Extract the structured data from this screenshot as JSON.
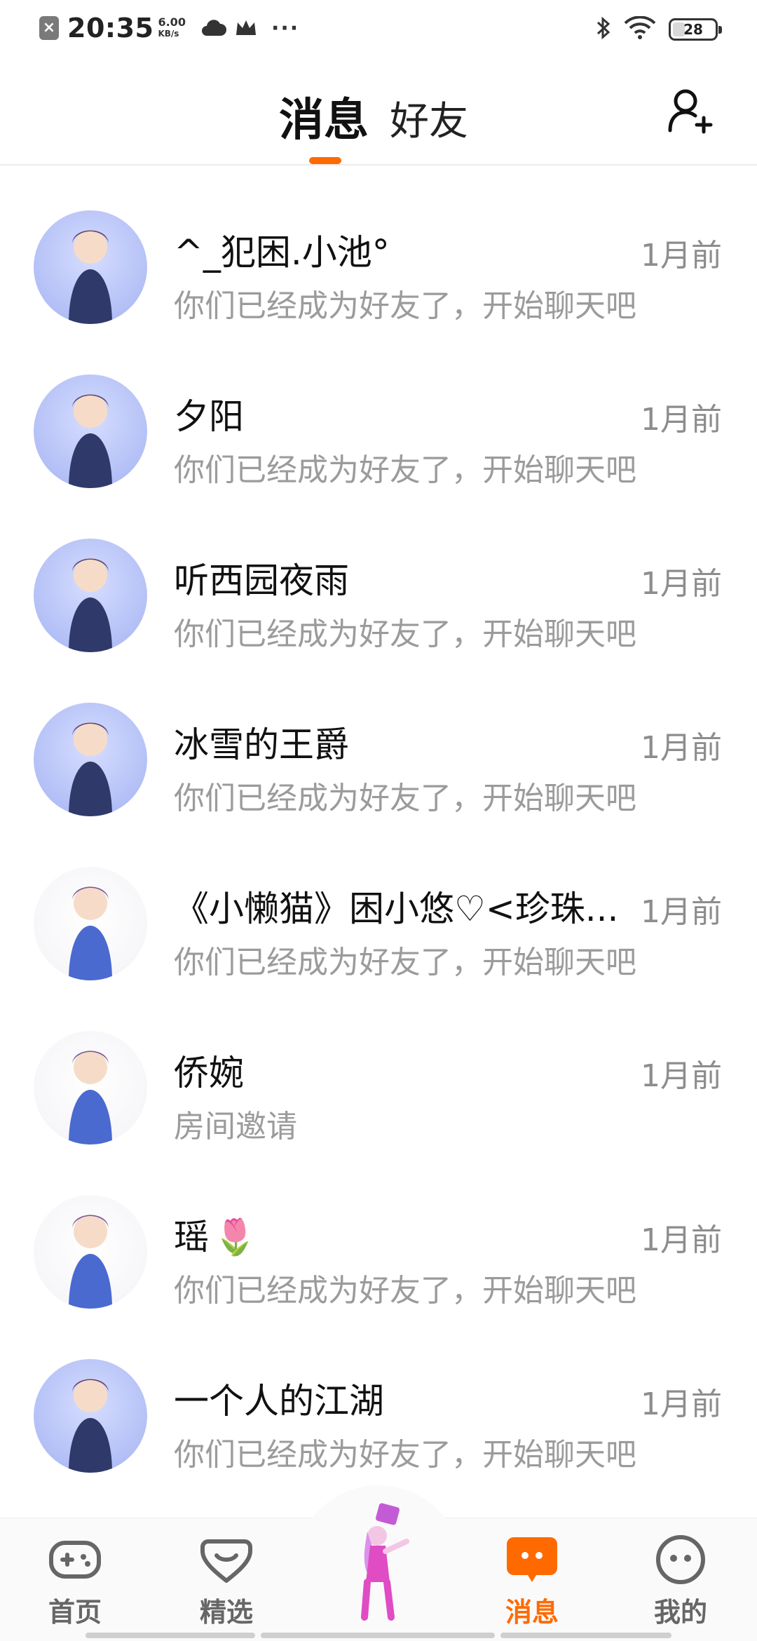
{
  "status_bar": {
    "time": "20:35",
    "net_speed_value": "6.00",
    "net_speed_unit": "KB/s",
    "icons": [
      "close-notification-icon",
      "weather-cloud-icon",
      "crown-icon",
      "more-dots-icon",
      "bluetooth-icon",
      "wifi-icon"
    ],
    "dots": "···",
    "battery_level": "28"
  },
  "header": {
    "tab_messages": "消息",
    "tab_friends": "好友",
    "active_tab": "消息",
    "accent_color": "#ff6a00"
  },
  "chats": [
    {
      "name": "^_犯困.小池°",
      "preview": "你们已经成为好友了，开始聊天吧",
      "time": "1月前",
      "avatar_style": "blue",
      "avatar_icon": "avatar-girl-icon"
    },
    {
      "name": "夕阳",
      "preview": "你们已经成为好友了，开始聊天吧",
      "time": "1月前",
      "avatar_style": "blue",
      "avatar_icon": "avatar-boy-icon"
    },
    {
      "name": "听西园夜雨",
      "preview": "你们已经成为好友了，开始聊天吧",
      "time": "1月前",
      "avatar_style": "blue",
      "avatar_icon": "avatar-horned-girl-icon"
    },
    {
      "name": "冰雪的王爵",
      "preview": "你们已经成为好友了，开始聊天吧",
      "time": "1月前",
      "avatar_style": "blue",
      "avatar_icon": "avatar-blonde-girl-icon"
    },
    {
      "name": "《小懒猫》困小悠♡<珍珠...",
      "preview": "你们已经成为好友了，开始聊天吧",
      "time": "1月前",
      "avatar_style": "white",
      "avatar_icon": "avatar-figure-icon"
    },
    {
      "name": "侨婉",
      "preview": "房间邀请",
      "time": "1月前",
      "avatar_style": "white",
      "avatar_icon": "avatar-figure-icon"
    },
    {
      "name": "瑶",
      "name_emoji": "🌷",
      "preview": "你们已经成为好友了，开始聊天吧",
      "time": "1月前",
      "avatar_style": "white",
      "avatar_icon": "avatar-figure-icon"
    },
    {
      "name": "一个人的江湖",
      "preview": "你们已经成为好友了，开始聊天吧",
      "time": "1月前",
      "avatar_style": "blue",
      "avatar_icon": "avatar-brown-hair-girl-icon"
    }
  ],
  "bottom_nav": {
    "items": [
      {
        "label": "首页",
        "icon": "gamepad-icon",
        "active": false
      },
      {
        "label": "精选",
        "icon": "heart-chat-icon",
        "active": false
      },
      {
        "label": "消息",
        "icon": "message-bubble-icon",
        "active": true
      },
      {
        "label": "我的",
        "icon": "face-icon",
        "active": false
      }
    ],
    "center_icon": "character-avatar-icon"
  }
}
